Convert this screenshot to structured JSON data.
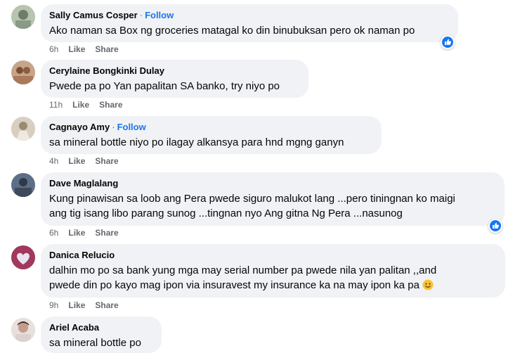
{
  "comments": [
    {
      "name": "Sally Camus Cosper",
      "follow": "Follow",
      "text_lines": [
        "Ako naman sa Box ng groceries matagal ko din binubuksan pero ok naman po"
      ],
      "time": "6h",
      "like": "Like",
      "share": "Share",
      "reaction": "like-reaction-icon"
    },
    {
      "name": "Cerylaine Bongkinki Dulay",
      "text_lines": [
        "Pwede pa po Yan papalitan SA banko, try niyo po"
      ],
      "time": "11h",
      "like": "Like",
      "share": "Share"
    },
    {
      "name": "Cagnayo Amy",
      "follow": "Follow",
      "text_lines": [
        "sa mineral bottle niyo po ilagay alkansya para hnd mgng ganyn"
      ],
      "time": "4h",
      "like": "Like",
      "share": "Share"
    },
    {
      "name": "Dave Maglalang",
      "text_lines": [
        "Kung pinawisan sa loob ang Pera pwede siguro malukot lang ...pero tiningnan ko maigi",
        "ang tig isang libo parang sunog ...tingnan nyo Ang gitna Ng Pera ...nasunog"
      ],
      "time": "6h",
      "like": "Like",
      "share": "Share",
      "reaction": "like-reaction-icon"
    },
    {
      "name": "Danica Relucio",
      "text_lines": [
        "dalhin mo po sa bank yung mga may serial number pa pwede nila yan palitan ,,and",
        "pwede din po kayo mag ipon via insuravest my insurance ka na may ipon ka pa"
      ],
      "emoji": "smiling-face-emoji",
      "time": "9h",
      "like": "Like",
      "share": "Share"
    },
    {
      "name": "Ariel Acaba",
      "text_lines": [
        "sa mineral bottle po"
      ]
    }
  ],
  "colors": {
    "bubble": "#f0f2f5",
    "follow": "#1877f2",
    "meta": "#65676b",
    "text": "#050505"
  }
}
